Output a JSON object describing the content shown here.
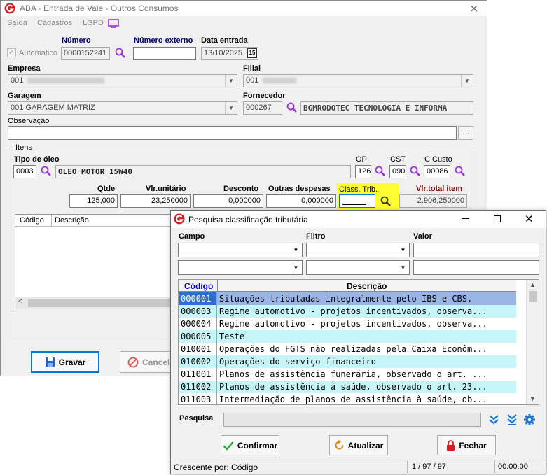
{
  "main_window": {
    "title": "ABA - Entrada de Vale - Outros Consumos",
    "menu": [
      "Saída",
      "Cadastros",
      "LGPD"
    ],
    "automatico_label": "Automático",
    "numero": {
      "label": "Número",
      "value": "0000152241"
    },
    "numero_externo": {
      "label": "Número externo",
      "value": ""
    },
    "data_entrada": {
      "label": "Data entrada",
      "value": "13/10/2025"
    },
    "empresa": {
      "label": "Empresa",
      "value": "001"
    },
    "filial": {
      "label": "Filial",
      "value": "001"
    },
    "garagem": {
      "label": "Garagem",
      "value": "001 GARAGEM MATRIZ"
    },
    "fornecedor": {
      "label": "Fornecedor",
      "code": "000267",
      "name": "BGMRODOTEC TECNOLOGIA E INFORMA"
    },
    "observacao": {
      "label": "Observação",
      "value": "",
      "ellipsis": "..."
    },
    "itens": {
      "group_label": "Itens",
      "tipo_oleo": {
        "label": "Tipo de óleo",
        "code": "0003",
        "name": "OLEO MOTOR 15W40"
      },
      "op": {
        "label": "OP",
        "value": "126"
      },
      "cst": {
        "label": "CST",
        "value": "090"
      },
      "ccusto": {
        "label": "C.Custo",
        "value": "00086"
      },
      "qtde": {
        "label": "Qtde",
        "value": "125,000"
      },
      "vlr_unitario": {
        "label": "Vlr.unitário",
        "value": "23,250000"
      },
      "desconto": {
        "label": "Desconto",
        "value": "0,000000"
      },
      "outras_despesas": {
        "label": "Outras despesas",
        "value": "0,000000"
      },
      "class_trib": {
        "label": "Class. Trib.",
        "value": ""
      },
      "vlr_total": {
        "label": "Vlr.total item",
        "value": "2.906,250000"
      },
      "grid_headers": [
        "Código",
        "Descrição"
      ]
    },
    "buttons": {
      "gravar": "Gravar",
      "cancelar": "Cancela"
    }
  },
  "dialog": {
    "title": "Pesquisa classificação tributária",
    "campo_label": "Campo",
    "filtro_label": "Filtro",
    "valor_label": "Valor",
    "grid_headers": {
      "codigo": "Código",
      "descricao": "Descrição"
    },
    "rows": [
      {
        "code": "000001",
        "desc": "Situações tributadas integralmente pelo IBS e CBS."
      },
      {
        "code": "000003",
        "desc": "Regime automotivo - projetos incentivados, observa..."
      },
      {
        "code": "000004",
        "desc": "Regime automotivo - projetos incentivados, observa..."
      },
      {
        "code": "000005",
        "desc": "Teste"
      },
      {
        "code": "010001",
        "desc": "Operações do FGTS não realizadas pela Caixa Econôm..."
      },
      {
        "code": "010002",
        "desc": "Operações do serviço financeiro"
      },
      {
        "code": "011001",
        "desc": "Planos de assistência funerária, observado o art. ..."
      },
      {
        "code": "011002",
        "desc": "Planos de assistência à saúde, observado o art. 23..."
      },
      {
        "code": "011003",
        "desc": "Intermediação de planos de assistência à saúde, ob..."
      }
    ],
    "pesquisa_label": "Pesquisa",
    "buttons": {
      "confirmar": "Confirmar",
      "atualizar": "Atualizar",
      "fechar": "Fechar"
    },
    "status": {
      "order": "Crescente por: Código",
      "count": "1 / 97 / 97",
      "time": "00:00:00"
    }
  },
  "colors": {
    "accent": "#0078d7",
    "highlight": "#ffff33",
    "selected_row": "#9ab5e6",
    "alt_row": "#c5f5f8",
    "navy": "#000080"
  }
}
